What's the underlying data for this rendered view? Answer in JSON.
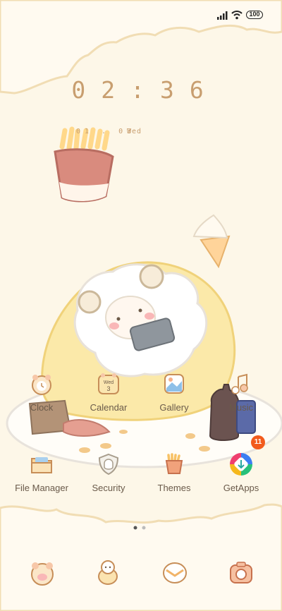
{
  "status_bar": {
    "battery": "100"
  },
  "clock": {
    "h1": "0",
    "h2": "2",
    "sep": ":",
    "m1": "3",
    "m2": "6"
  },
  "date": {
    "text": "01 . 03",
    "weekday": "Wed"
  },
  "apps_row1": [
    {
      "label": "Clock",
      "icon": "clock-icon"
    },
    {
      "label": "Calendar",
      "icon": "calendar-icon",
      "icon_text_top": "Wed",
      "icon_text_bottom": "3"
    },
    {
      "label": "Gallery",
      "icon": "gallery-icon"
    },
    {
      "label": "Music",
      "icon": "music-icon"
    }
  ],
  "apps_row2": [
    {
      "label": "File Manager",
      "icon": "folder-icon"
    },
    {
      "label": "Security",
      "icon": "shield-icon"
    },
    {
      "label": "Themes",
      "icon": "fries-icon"
    },
    {
      "label": "GetApps",
      "icon": "getapps-icon",
      "badge": "11"
    }
  ],
  "dock": [
    {
      "icon": "phone-icon"
    },
    {
      "icon": "contacts-icon"
    },
    {
      "icon": "messages-icon"
    },
    {
      "icon": "camera-icon"
    }
  ],
  "page_indicator": {
    "count": 2,
    "active": 0
  },
  "colors": {
    "background": "#fdf7e8",
    "accent": "#c89e6f",
    "badge": "#f25b1d"
  }
}
